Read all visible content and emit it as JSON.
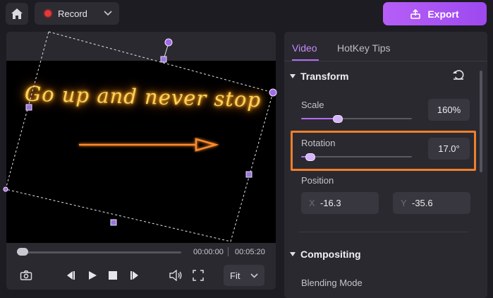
{
  "topbar": {
    "home_icon": "home-icon",
    "record_label": "Record",
    "record_dot_color": "#e5383b",
    "export_label": "Export",
    "export_color": "#a552f2"
  },
  "preview": {
    "overlay_text": "Go up and never stop",
    "time_current": "00:00:00",
    "time_total": "00:05:20",
    "progress": 0.0,
    "zoom_option": "Fit"
  },
  "panel": {
    "tabs": [
      {
        "label": "Video",
        "active": true
      },
      {
        "label": "HotKey Tips",
        "active": false
      }
    ],
    "transform": {
      "title": "Transform",
      "scale_label": "Scale",
      "scale_value": "160%",
      "scale_fraction": 0.33,
      "rotation_label": "Rotation",
      "rotation_value": "17.0°",
      "rotation_fraction": 0.08,
      "position_label": "Position",
      "x_axis": "X",
      "x_value": "-16.3",
      "y_axis": "Y",
      "y_value": "-35.6"
    },
    "compositing": {
      "title": "Compositing",
      "blending_label": "Blending Mode"
    }
  },
  "colors": {
    "accent": "#b66cf6",
    "highlight": "#f07f2b",
    "background": "#1d1c22"
  }
}
